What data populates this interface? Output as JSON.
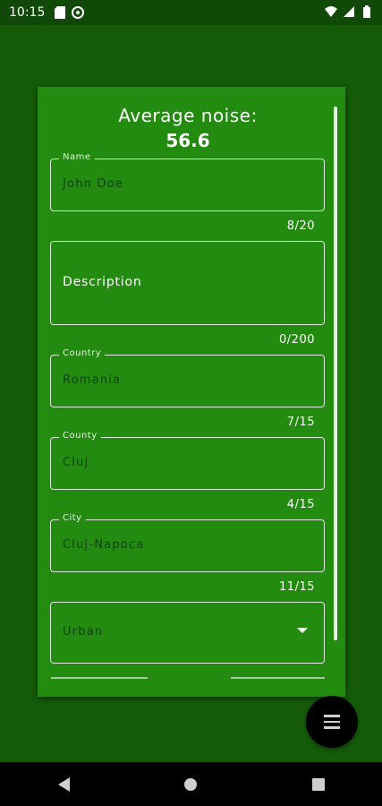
{
  "status_bar": {
    "time": "10:15",
    "left_icons": [
      "sd-card-icon",
      "sync-icon"
    ],
    "right_icons": [
      "wifi-icon",
      "signal-icon",
      "battery-icon"
    ]
  },
  "dialog": {
    "title": "Average noise:",
    "value": "56.6",
    "fields": {
      "name": {
        "label": "Name",
        "value": "John Doe",
        "counter": "8/20"
      },
      "description": {
        "placeholder": "Description",
        "counter": "0/200"
      },
      "country": {
        "label": "Country",
        "value": "Romania",
        "counter": "7/15"
      },
      "county": {
        "label": "County",
        "value": "Cluj",
        "counter": "4/15"
      },
      "city": {
        "label": "City",
        "value": "Cluj-Napoca",
        "counter": "11/15"
      },
      "area_type": {
        "selected": "Urban"
      }
    }
  },
  "fab": {
    "icon": "menu-icon"
  },
  "nav": {
    "icons": [
      "back-icon",
      "home-icon",
      "recents-icon"
    ]
  },
  "colors": {
    "background": "#145a09",
    "dialog": "#238c10",
    "field_text": "#0d3f08"
  }
}
